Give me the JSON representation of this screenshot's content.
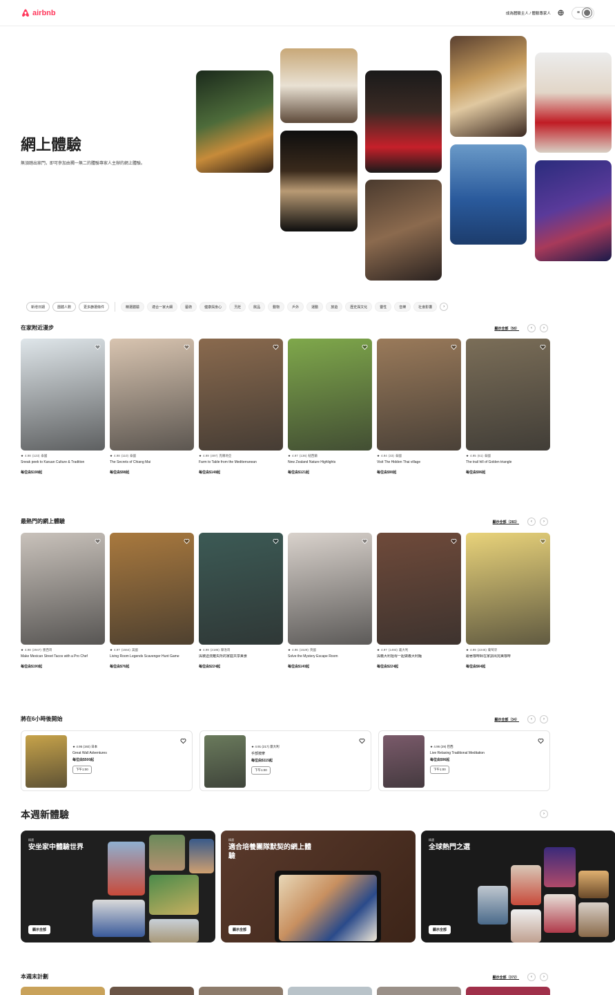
{
  "header": {
    "logo_text": "airbnb",
    "host_link": "成為體驗主人 / 體驗專家人",
    "menu_icon": "menu-icon"
  },
  "hero": {
    "title": "網上體驗",
    "subtitle": "無須踏出家門，即可參加由獨一無二的體驗專家人主辦的網上體驗。"
  },
  "filters": {
    "chips_left": [
      "新增日期",
      "團體人數",
      "更多篩選條件"
    ],
    "chips_right": [
      "精選體驗",
      "適合一家大細",
      "藝術",
      "健康與身心",
      "烹飪",
      "烹飪",
      "飲品",
      "戶外",
      "動物",
      "運動",
      "旅遊",
      "歷史與文化",
      "靈性",
      "音樂",
      "社會影響"
    ],
    "more_chip": "更多"
  },
  "sections": {
    "near": {
      "title": "在家附近漫步",
      "show_all": "顯示全部（58）"
    },
    "popular": {
      "title": "最熱門的網上體驗",
      "show_all": "顯示全部（283）"
    },
    "soon": {
      "title": "將在6小時後開始",
      "show_all": "顯示全部（34）"
    },
    "new_week": {
      "title": "本週新體驗"
    },
    "weekend": {
      "title": "本週末計劃",
      "show_all": "顯示全部（372）"
    }
  },
  "near_cards": [
    {
      "rating": "4.98",
      "reviews": "(123)",
      "place": "泰國",
      "title": "Sneak peek to Karuan Culture & Tradition",
      "price": "每位由$198起",
      "color": "#dfe6ea"
    },
    {
      "rating": "4.98",
      "reviews": "(110)",
      "place": "泰國",
      "title": "The Secrets of Chiang Mai",
      "price": "每位由$98起",
      "color": "#d8c4b0"
    },
    {
      "rating": "4.99",
      "reviews": "(497)",
      "place": "克羅地亞",
      "title": "Farm to Table from the Mediterranean",
      "price": "每位由$148起",
      "color": "#8a6a4e"
    },
    {
      "rating": "4.97",
      "reviews": "(136)",
      "place": "紐西蘭",
      "title": "New Zealand Nature Highlights",
      "price": "每位由$121起",
      "color": "#7fa84b"
    },
    {
      "rating": "4.94",
      "reviews": "(33)",
      "place": "泰國",
      "title": "Visit The Hidden Thai village",
      "price": "每位由$90起",
      "color": "#9a7a5a"
    },
    {
      "rating": "4.95",
      "reviews": "(61)",
      "place": "泰國",
      "title": "The trail hill of Golden triangle",
      "price": "每位由$96起",
      "color": "#7b6e58"
    }
  ],
  "popular_cards": [
    {
      "rating": "4.98",
      "reviews": "(2947)",
      "place": "墨西哥",
      "title": "Make Mexican Street Tacos with a Pro Chef",
      "price": "每位由$190起",
      "color": "#c9c2bb"
    },
    {
      "rating": "4.97",
      "reviews": "(1564)",
      "place": "美國",
      "title": "Living Room Legends Scavenger Hunt Game",
      "price": "每位由$76起",
      "color": "#a9793e"
    },
    {
      "rating": "4.99",
      "reviews": "(2186)",
      "place": "摩洛哥",
      "title": "與被迫流離失所的家庭共享美食",
      "price": "每位由$224起",
      "color": "#3c5a55"
    },
    {
      "rating": "4.96",
      "reviews": "(1529)",
      "place": "英國",
      "title": "Solve the Mystery Escape Room",
      "price": "每位由$140起",
      "color": "#d9d2cc"
    },
    {
      "rating": "4.97",
      "reviews": "(1493)",
      "place": "義大利",
      "title": "與義大利祖母一起做義大利麵",
      "price": "每位由$224起",
      "color": "#6f4a3a"
    },
    {
      "rating": "4.99",
      "reviews": "(2245)",
      "place": "葡萄牙",
      "title": "跟著咖啡師在家調出完美咖啡",
      "price": "每位由$64起",
      "color": "#e9d37a"
    }
  ],
  "soon_cards": [
    {
      "rating": "4.95",
      "reviews": "(192)",
      "place": "日本",
      "title": "Great Wall Adventures",
      "price": "每位由$500起",
      "slot": "下午1:00",
      "color": "#c7a34a"
    },
    {
      "rating": "4.91",
      "reviews": "(217)",
      "place": "意大利",
      "title": "手部按摩",
      "price": "每位由$115起",
      "slot": "下午1:00",
      "color": "#6a7a5c"
    },
    {
      "rating": "4.96",
      "reviews": "(29)",
      "place": "巴西",
      "title": "Live Relaxing Traditional Meditation",
      "price": "每位由$96起",
      "slot": "下午1:00",
      "color": "#7a5a6a"
    }
  ],
  "banners": [
    {
      "tag": "精選",
      "title": "安坐家中體驗世界",
      "button": "顯示全部",
      "bg": "#1f1f1f"
    },
    {
      "tag": "精選",
      "title": "適合培養團隊默契的網上體驗",
      "button": "顯示全部",
      "bg": "#4a2c22"
    },
    {
      "tag": "精選",
      "title": "全球熱門之選",
      "button": "顯示全部",
      "bg": "#1a1a1a"
    }
  ],
  "weekend_cards": [
    {
      "color": "#c9a25a"
    },
    {
      "color": "#6b5546"
    },
    {
      "color": "#8d7b6b"
    },
    {
      "color": "#b9c3c9"
    },
    {
      "color": "#9a9088"
    },
    {
      "color": "#a0304a"
    }
  ]
}
